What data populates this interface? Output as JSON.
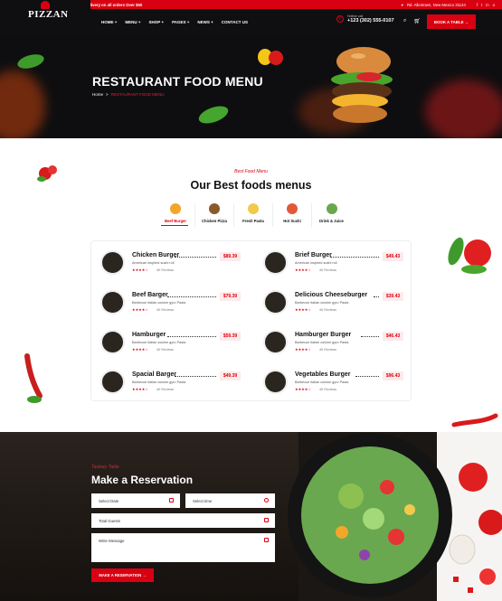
{
  "topbar": {
    "promo": "Free Delivery on all orders Over $50",
    "address": "Rd. Allentown, New Mexico 31134",
    "social": [
      "f",
      "t",
      "in",
      "o"
    ]
  },
  "header": {
    "logo": "PIZZAN",
    "nav": [
      "HOME +",
      "MENU +",
      "SHOP +",
      "PAGES +",
      "NEWS +",
      "CONTACT US"
    ],
    "phone_label": "Hotline call",
    "phone": "+123 (302) 555-0107",
    "book_label": "BOOK A TABLE →"
  },
  "hero": {
    "title": "RESTAURANT FOOD MENU",
    "crumb_home": "Home",
    "crumb_sep": ">",
    "crumb_current": "RESTAURANT FOOD MENU"
  },
  "menu": {
    "subtitle": "Best Food Menu",
    "title": "Our Best foods menus",
    "tabs": [
      {
        "label": "Beef Burger",
        "color": "#f2a62a"
      },
      {
        "label": "Chicken Pizza",
        "color": "#8a5a2b"
      },
      {
        "label": "Fresh Pasta",
        "color": "#f2c94c"
      },
      {
        "label": "Hot Sushi",
        "color": "#e05a3a"
      },
      {
        "label": "Drink & Juice",
        "color": "#6aa84f"
      }
    ],
    "items": [
      {
        "name": "Chicken Burger",
        "desc": "American inspired sushi roll",
        "stars": "★★★★☆",
        "reviews": "4K Reviews",
        "price": "$89.39"
      },
      {
        "name": "Brief Burger",
        "desc": "American inspired sushi roll",
        "stars": "★★★★☆",
        "reviews": "4K Reviews",
        "price": "$49.43"
      },
      {
        "name": "Beef Barger",
        "desc": "Barbecue italian cuisine gyro Pasta",
        "stars": "★★★★☆",
        "reviews": "4K Reviews",
        "price": "$79.39"
      },
      {
        "name": "Delicious Cheeseburger",
        "desc": "Barbecue italian cuisine gyro Pasta",
        "stars": "★★★★☆",
        "reviews": "4K Reviews",
        "price": "$39.43"
      },
      {
        "name": "Hamburger",
        "desc": "Barbecue italian cuisine gyro Pasta",
        "stars": "★★★★☆",
        "reviews": "4K Reviews",
        "price": "$59.39"
      },
      {
        "name": "Hamburger Burger",
        "desc": "Barbecue italian cuisine gyro Pasta",
        "stars": "★★★★☆",
        "reviews": "4K Reviews",
        "price": "$46.43"
      },
      {
        "name": "Spacial Barger",
        "desc": "Barbecue italian cuisine gyro Pasta",
        "stars": "★★★★☆",
        "reviews": "4K Reviews",
        "price": "$49.39"
      },
      {
        "name": "Vegetables Burger",
        "desc": "Barbecue italian cuisine gyro Pasta",
        "stars": "★★★★☆",
        "reviews": "4K Reviews",
        "price": "$96.43"
      }
    ]
  },
  "reservation": {
    "subtitle": "Tastney Table",
    "title": "Make a Reservation",
    "date_placeholder": "Select Date",
    "time_placeholder": "Select time",
    "guests_placeholder": "Total Guests",
    "message_placeholder": "Write Message",
    "submit_label": "MAKE A RESERVATION →"
  },
  "colors": {
    "accent": "#d90011",
    "dark": "#0f0f12"
  }
}
